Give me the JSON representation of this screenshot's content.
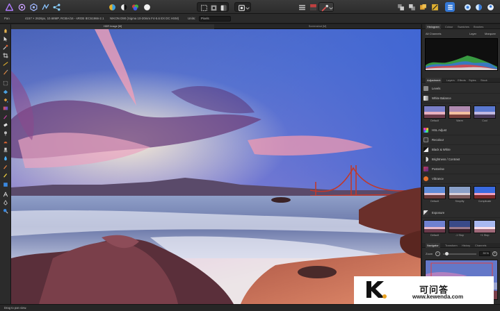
{
  "toolbar": {
    "personas": [
      "photo-persona-icon",
      "liquify-persona-icon",
      "develop-persona-icon",
      "tone-map-persona-icon",
      "export-persona-icon"
    ],
    "colors": {
      "accent": "#7e57c2",
      "selected": "#3478d6"
    }
  },
  "context": {
    "layer_type": "Pan",
    "document_info": "4157 × 2626px, 10.68MP, RGBA/16 - sRGB IEC61966-2.1",
    "lens_info": "NIKON D90 (Sigma 10-20mm F4-5.6 EX DC HSM)",
    "units_label": "Units:",
    "units_value": "Pixels"
  },
  "tabs": [
    {
      "label": "HDR Image [M]",
      "active": true
    },
    {
      "label": "Screenshot [M]",
      "active": false
    }
  ],
  "panel": {
    "top_tabs": [
      "Histogram",
      "Colour",
      "Swatches",
      "Brushes"
    ],
    "histogram": {
      "channel": "All Channels",
      "layer_label": "Layer",
      "marquee_label": "Marquee"
    },
    "mid_tabs": [
      "Adjustment",
      "Layers",
      "Effects",
      "Styles",
      "Stock"
    ],
    "adjustments": [
      {
        "label": "Levels",
        "icon": "levels-icon",
        "color": "#8a8a8a"
      },
      {
        "label": "White Balance",
        "icon": "white-balance-icon",
        "color": "#b8b8b8"
      },
      {
        "label": "HSL Adjust",
        "icon": "hsl-icon",
        "color": "#e06a2c"
      },
      {
        "label": "Recolour",
        "icon": "recolour-icon",
        "color": "#3a3a3a"
      },
      {
        "label": "Black & White",
        "icon": "black-white-icon",
        "color": "#111111"
      },
      {
        "label": "Brightness / Contrast",
        "icon": "brightness-icon",
        "color": "#777777"
      },
      {
        "label": "Posterise",
        "icon": "posterise-icon",
        "color": "#c43b5a"
      },
      {
        "label": "Vibrance",
        "icon": "vibrance-icon",
        "color": "#e8722a"
      },
      {
        "label": "Exposure",
        "icon": "exposure-icon",
        "color": "#9a9a9a"
      }
    ],
    "wb_presets": [
      "Default",
      "Warm",
      "Cool"
    ],
    "vibrance_presets": [
      "Default",
      "Simplify",
      "Complicate"
    ],
    "exposure_presets": [
      "Default",
      "-1 Stop",
      "+1 Stop"
    ],
    "bottom_tabs": [
      "Navigator",
      "Transform",
      "History",
      "Channels"
    ],
    "navigator": {
      "zoom_label": "Zoom",
      "zoom_value": "39 %"
    }
  },
  "status": {
    "hint": "Drag to pan view."
  },
  "watermark": {
    "logo_letter": "K",
    "chinese": "可问答",
    "url": "www.kewenda.com"
  }
}
